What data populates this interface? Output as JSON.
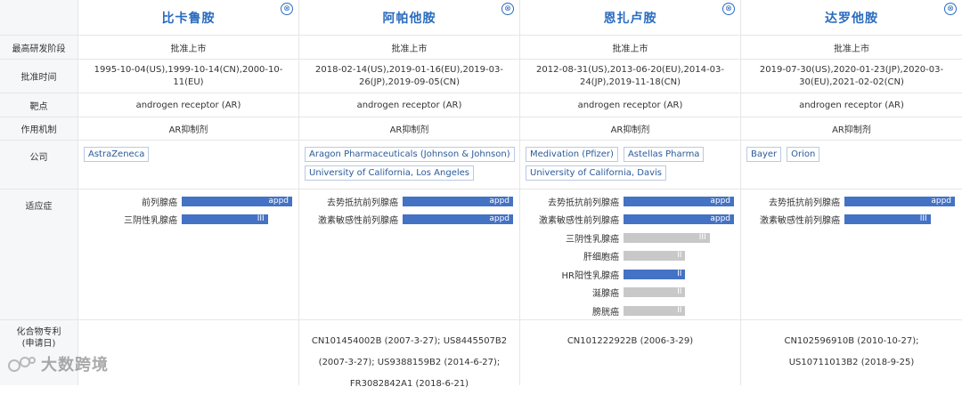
{
  "drugs": [
    {
      "name": "比卡鲁胺",
      "stage": "批准上市",
      "approval": "1995-10-04(US),1999-10-14(CN),2000-10-11(EU)",
      "target": "androgen receptor (AR)",
      "mechanism": "AR抑制剂",
      "companies": [
        "AstraZeneca"
      ],
      "indications": [
        {
          "name": "前列腺癌",
          "stage": "appd",
          "level": 1.0,
          "color": "blue"
        },
        {
          "name": "三阴性乳腺癌",
          "stage": "III",
          "level": 0.78,
          "color": "blue"
        }
      ],
      "patent": ""
    },
    {
      "name": "阿帕他胺",
      "stage": "批准上市",
      "approval": "2018-02-14(US),2019-01-16(EU),2019-03-26(JP),2019-09-05(CN)",
      "target": "androgen receptor (AR)",
      "mechanism": "AR抑制剂",
      "companies": [
        "Aragon Pharmaceuticals (Johnson & Johnson)",
        "University of California, Los Angeles"
      ],
      "indications": [
        {
          "name": "去势抵抗前列腺癌",
          "stage": "appd",
          "level": 1.0,
          "color": "blue"
        },
        {
          "name": "激素敏感性前列腺癌",
          "stage": "appd",
          "level": 1.0,
          "color": "blue"
        }
      ],
      "patent": "CN101454002B (2007-3-27); US8445507B2 (2007-3-27); US9388159B2 (2014-6-27); FR3082842A1 (2018-6-21)"
    },
    {
      "name": "恩扎卢胺",
      "stage": "批准上市",
      "approval": "2012-08-31(US),2013-06-20(EU),2014-03-24(JP),2019-11-18(CN)",
      "target": "androgen receptor (AR)",
      "mechanism": "AR抑制剂",
      "companies": [
        "Medivation (Pfizer)",
        "Astellas Pharma",
        "University of California, Davis"
      ],
      "indications": [
        {
          "name": "去势抵抗前列腺癌",
          "stage": "appd",
          "level": 1.0,
          "color": "blue"
        },
        {
          "name": "激素敏感性前列腺癌",
          "stage": "appd",
          "level": 1.0,
          "color": "blue"
        },
        {
          "name": "三阴性乳腺癌",
          "stage": "III",
          "level": 0.78,
          "color": "gray"
        },
        {
          "name": "肝细胞癌",
          "stage": "II",
          "level": 0.56,
          "color": "gray"
        },
        {
          "name": "HR阳性乳腺癌",
          "stage": "II",
          "level": 0.56,
          "color": "blue"
        },
        {
          "name": "涎腺癌",
          "stage": "II",
          "level": 0.56,
          "color": "gray"
        },
        {
          "name": "膀胱癌",
          "stage": "II",
          "level": 0.56,
          "color": "gray"
        }
      ],
      "patent": "CN101222922B (2006-3-29)"
    },
    {
      "name": "达罗他胺",
      "stage": "批准上市",
      "approval": "2019-07-30(US),2020-01-23(JP),2020-03-30(EU),2021-02-02(CN)",
      "target": "androgen receptor (AR)",
      "mechanism": "AR抑制剂",
      "companies": [
        "Bayer",
        "Orion"
      ],
      "indications": [
        {
          "name": "去势抵抗前列腺癌",
          "stage": "appd",
          "level": 1.0,
          "color": "blue"
        },
        {
          "name": "激素敏感性前列腺癌",
          "stage": "III",
          "level": 0.78,
          "color": "blue"
        }
      ],
      "patent": "CN102596910B (2010-10-27); US10711013B2 (2018-9-25)"
    }
  ],
  "labels": {
    "stage": "最高研发阶段",
    "approval": "批准时间",
    "target": "靶点",
    "mechanism": "作用机制",
    "company": "公司",
    "indication": "适应症",
    "patent": "化合物专利\n(申请日)"
  },
  "close_glyph": "⊗",
  "watermark": "大数跨境",
  "colors": {
    "blue": "#4472c4",
    "gray": "#c8c8c8",
    "link": "#2a6bbf"
  }
}
